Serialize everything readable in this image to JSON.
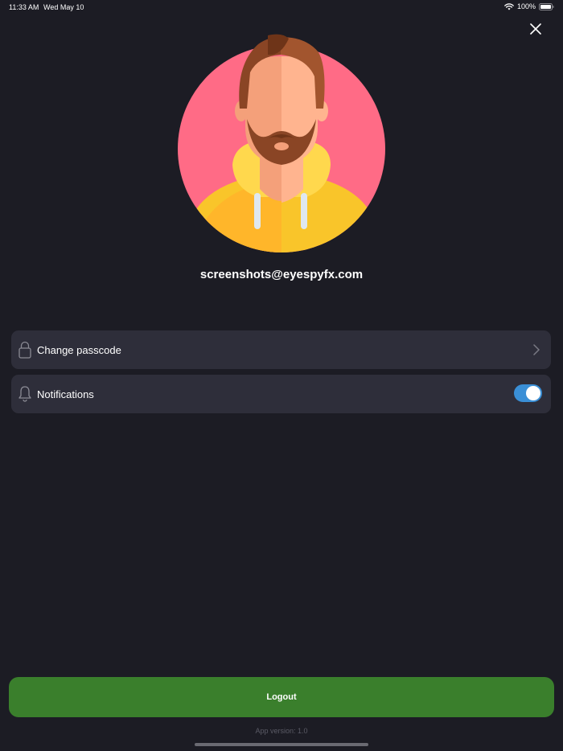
{
  "status_bar": {
    "time": "11:33 AM",
    "date": "Wed May 10",
    "battery": "100%",
    "icons": [
      "wifi-icon",
      "battery-icon"
    ]
  },
  "header": {
    "close_icon": "close-icon"
  },
  "profile": {
    "email": "screenshots@eyespyfx.com",
    "avatar_background": "#ff6b86"
  },
  "settings": {
    "items": [
      {
        "label": "Change passcode",
        "icon": "lock-icon",
        "trailing": "chevron-right-icon"
      },
      {
        "label": "Notifications",
        "icon": "bell-icon",
        "trailing": "toggle",
        "enabled": true
      }
    ]
  },
  "footer": {
    "logout_label": "Logout",
    "app_version": "App version: 1.0"
  },
  "colors": {
    "background": "#1c1c24",
    "row_background": "#2e2e3a",
    "toggle_on": "#3a8fd6",
    "logout": "#3a7f2c"
  }
}
